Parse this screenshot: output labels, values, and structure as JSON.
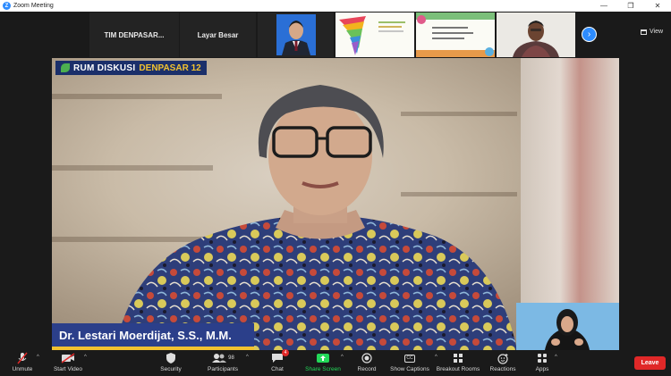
{
  "window": {
    "title": "Zoom Meeting",
    "logo_letter": "Z",
    "controls": [
      "—",
      "❐",
      "✕"
    ]
  },
  "strip": {
    "tiles": [
      {
        "label": "TIM  DENPASAR..."
      },
      {
        "label": "Layar Besar"
      }
    ],
    "view_label": "View"
  },
  "main": {
    "banner_title": "RUM DISKUSI",
    "banner_sub": "DENPASAR 12",
    "speaker_name": "Dr. Lestari Moerdijat, S.S., M.M."
  },
  "toolbar": {
    "items": [
      {
        "label": "Unmute",
        "icon": "microphone-muted-icon"
      },
      {
        "label": "Start Video",
        "icon": "video-off-icon"
      },
      {
        "label": "Security",
        "icon": "shield-icon"
      },
      {
        "label": "Participants",
        "icon": "people-icon",
        "count": "98"
      },
      {
        "label": "Chat",
        "icon": "chat-icon",
        "badge": "4"
      },
      {
        "label": "Share Screen",
        "icon": "share-screen-icon"
      },
      {
        "label": "Record",
        "icon": "record-icon"
      },
      {
        "label": "Show Captions",
        "icon": "captions-icon",
        "icon_text": "CC"
      },
      {
        "label": "Breakout Rooms",
        "icon": "breakout-rooms-icon"
      },
      {
        "label": "Reactions",
        "icon": "reactions-icon"
      },
      {
        "label": "Apps",
        "icon": "apps-icon"
      }
    ],
    "leave_label": "Leave"
  },
  "colors": {
    "zoom_blue": "#2d8cff",
    "share_green": "#23d959",
    "leave_red": "#e02828",
    "caption_blue": "#2b3f8a",
    "banner_yellow": "#f2c230"
  }
}
